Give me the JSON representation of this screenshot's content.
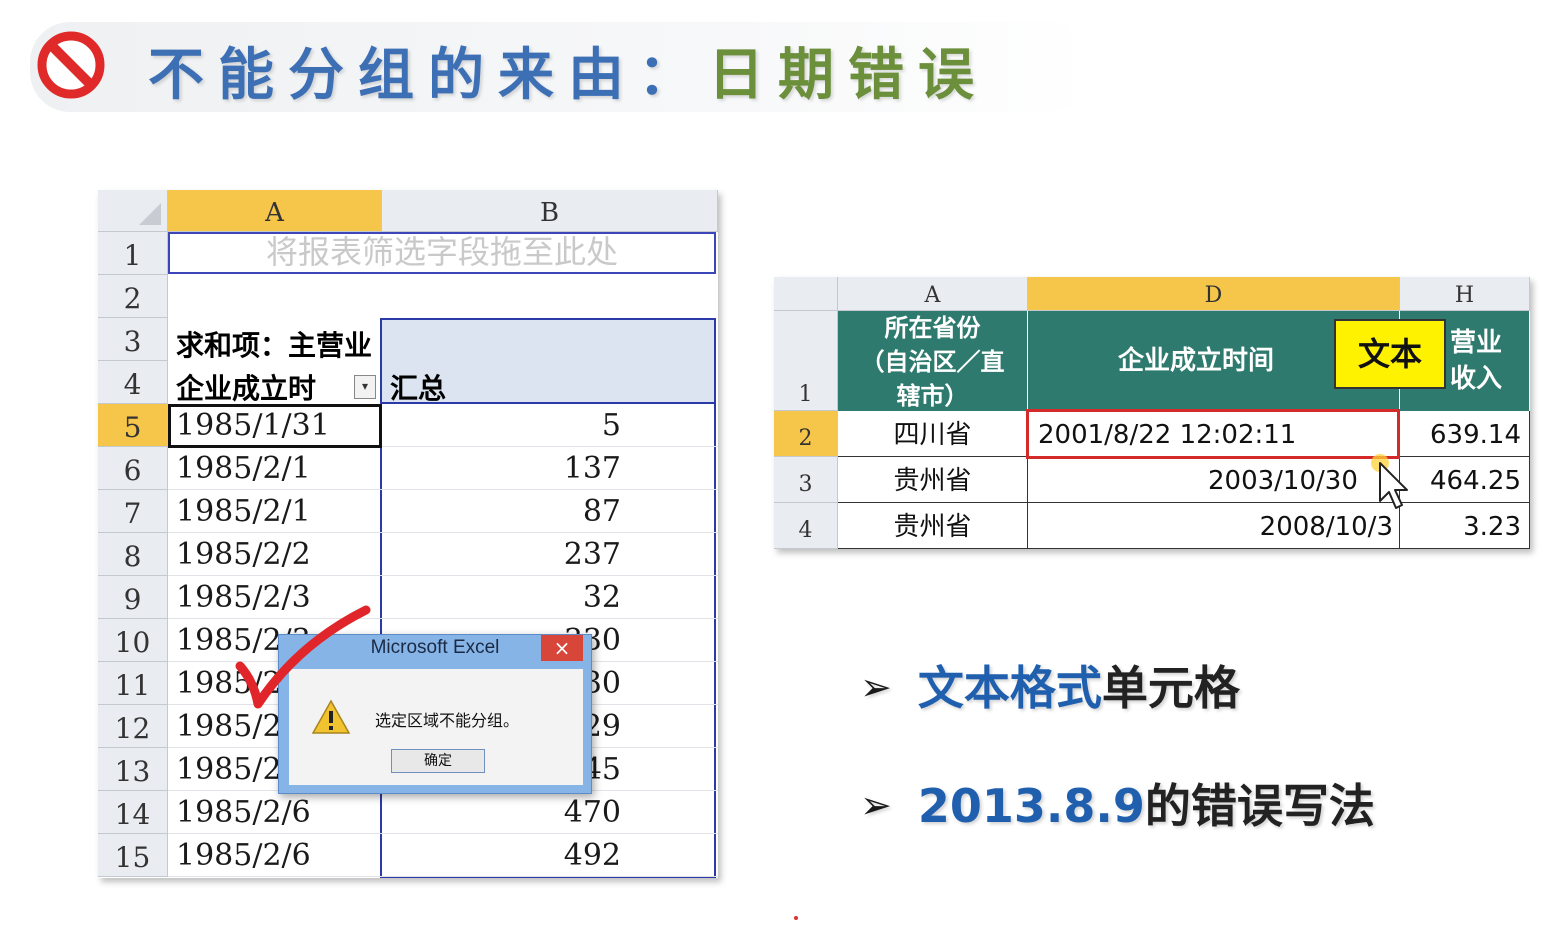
{
  "title": {
    "prefix": "不能分组的来由：",
    "accent": "日期错误"
  },
  "left_sheet": {
    "col_a": "A",
    "col_b": "B",
    "filter_placeholder": "将报表筛选字段拖至此处",
    "row_headers": [
      "1",
      "2",
      "3",
      "4",
      "5",
      "6",
      "7",
      "8",
      "9",
      "10",
      "11",
      "12",
      "13",
      "14",
      "15"
    ],
    "sum_label": "求和项：主营业",
    "row_field": "企业成立时",
    "total_label": "汇总",
    "rows": [
      {
        "a": "1985/1/31",
        "b": "5"
      },
      {
        "a": "1985/2/1",
        "b": "137"
      },
      {
        "a": "1985/2/1",
        "b": "87"
      },
      {
        "a": "1985/2/2",
        "b": "237"
      },
      {
        "a": "1985/2/3",
        "b": "32"
      },
      {
        "a": "1985/2/3",
        "b": "330"
      },
      {
        "a": "1985/2/4",
        "b": "130"
      },
      {
        "a": "1985/2/5",
        "b": "529"
      },
      {
        "a": "1985/2/6",
        "b": "645"
      },
      {
        "a": "1985/2/6",
        "b": "470"
      },
      {
        "a": "1985/2/6",
        "b": "492"
      }
    ]
  },
  "dialog": {
    "title": "Microsoft Excel",
    "close": "×",
    "message": "选定区域不能分组。",
    "ok": "确定"
  },
  "right_sheet": {
    "col_a": "A",
    "col_d": "D",
    "col_h": "H",
    "row_headers": [
      "1",
      "2",
      "3",
      "4"
    ],
    "header_a": "所在省份（自治区／直辖市）",
    "header_a_lines": [
      "所在省份",
      "（自治区／直",
      "辖市）"
    ],
    "header_d": "企业成立时间",
    "header_h_lines": [
      "营业",
      "收入"
    ],
    "badge": "文本",
    "rows": [
      {
        "province": "四川省",
        "date": "2001/8/22  12:02:11",
        "revenue": "639.14"
      },
      {
        "province": "贵州省",
        "date": "2003/10/30",
        "revenue": "464.25"
      },
      {
        "province": "贵州省",
        "date": "2008/10/3",
        "revenue": "3.23"
      }
    ]
  },
  "bullets": [
    {
      "arrow": "➢",
      "blue": "文本格式",
      "black": "单元格"
    },
    {
      "arrow": "➢",
      "blue": "2013.8.9",
      "black": "的错误写法"
    }
  ]
}
